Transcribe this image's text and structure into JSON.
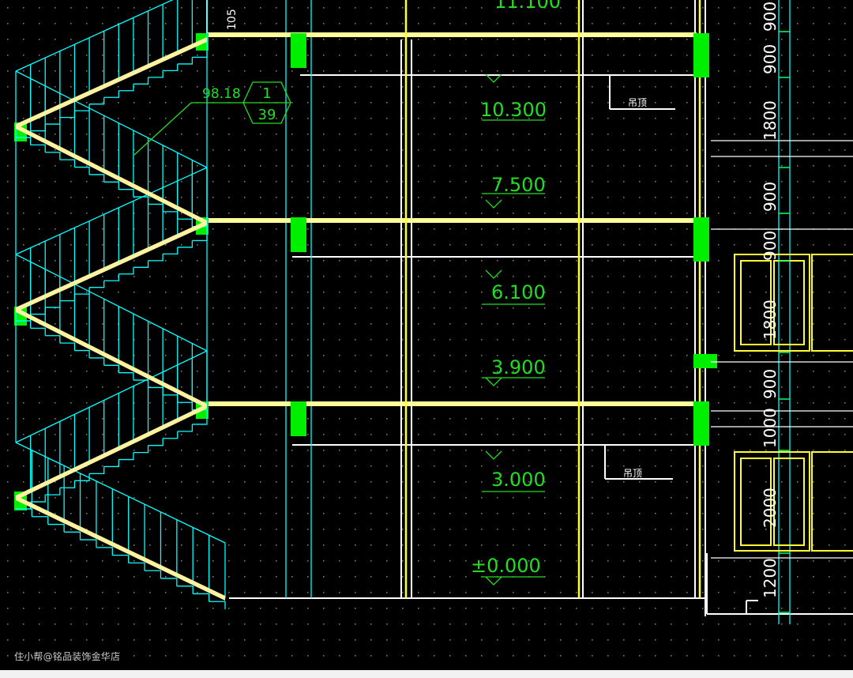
{
  "colors": {
    "background": "#000000",
    "slab": "#ffff99",
    "column": "#00ff00",
    "stair": "#00ffff",
    "stair_tread": "#fff3a0",
    "text": "#22dd22",
    "line": "#ffffff",
    "window": "#ffff33",
    "grid_dot": "#7a7a7a"
  },
  "drawing": {
    "elevations": [
      "10.300",
      "7.500",
      "6.100",
      "3.900",
      "3.000",
      "±0.000",
      "11.100"
    ],
    "dimensions": [
      "900",
      "900",
      "1800",
      "900",
      "900",
      "1800",
      "900",
      "1000",
      "2000",
      "1200",
      "105"
    ],
    "callout": {
      "label": "98.18",
      "number": "1",
      "sheet": "39"
    },
    "notes": [
      "吊顶",
      "吊顶"
    ]
  },
  "watermark": "住小帮@铭品装饰金华店"
}
